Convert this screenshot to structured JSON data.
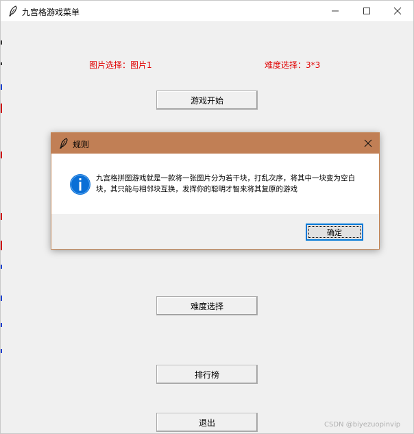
{
  "window": {
    "title": "九宫格游戏菜单"
  },
  "labels": {
    "image_select": "图片选择：图片1",
    "difficulty_select": "难度选择：3*3"
  },
  "buttons": {
    "start": "游戏开始",
    "difficulty": "难度选择",
    "leaderboard": "排行榜",
    "exit": "退出"
  },
  "dialog": {
    "title": "规则",
    "message": "九宫格拼图游戏就是一款将一张图片分为若干块，打乱次序，将其中一块变为空白块，其只能与相邻块互换，发挥你的聪明才智来将其复原的游戏",
    "ok": "确定",
    "icon": "info-icon"
  },
  "watermark": "CSDN @biyezuopinvip",
  "colors": {
    "label_red": "#e00000",
    "dialog_titlebar": "#c17f55",
    "info_blue": "#0a6fd6",
    "focus_blue": "#0078d7"
  }
}
